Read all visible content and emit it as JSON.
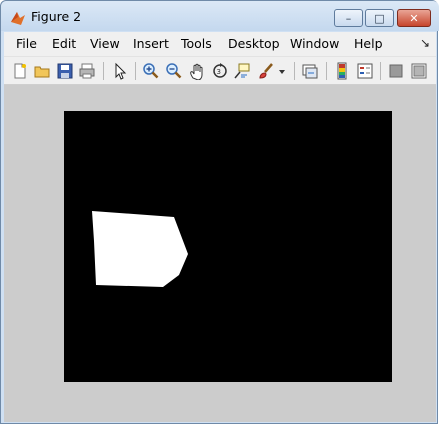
{
  "window": {
    "title": "Figure 2"
  },
  "title_buttons": {
    "minimize": "–",
    "maximize": "□",
    "close": "✕"
  },
  "menu": {
    "items": [
      "File",
      "Edit",
      "View",
      "Insert",
      "Tools",
      "Desktop",
      "Window",
      "Help"
    ],
    "dock_glyph": "↘"
  },
  "toolbar": {
    "icons": [
      "new-figure-icon",
      "open-file-icon",
      "save-icon",
      "print-icon",
      "edit-plot-arrow-icon",
      "zoom-in-icon",
      "zoom-out-icon",
      "pan-hand-icon",
      "rotate-3d-icon",
      "data-cursor-icon",
      "brush-icon",
      "brush-dropdown-icon",
      "link-plot-icon",
      "colorbar-icon",
      "legend-icon",
      "hide-plot-tools-icon",
      "show-plot-tools-icon"
    ]
  },
  "colors": {
    "axes_background": "#000000",
    "shape_fill": "#ffffff",
    "figure_background": "#cccccc",
    "toolbar_background": "#f0f0f0",
    "titlebar": "#c4d8ee"
  },
  "image": {
    "description_free": true,
    "shape": "white-polygon-region"
  }
}
